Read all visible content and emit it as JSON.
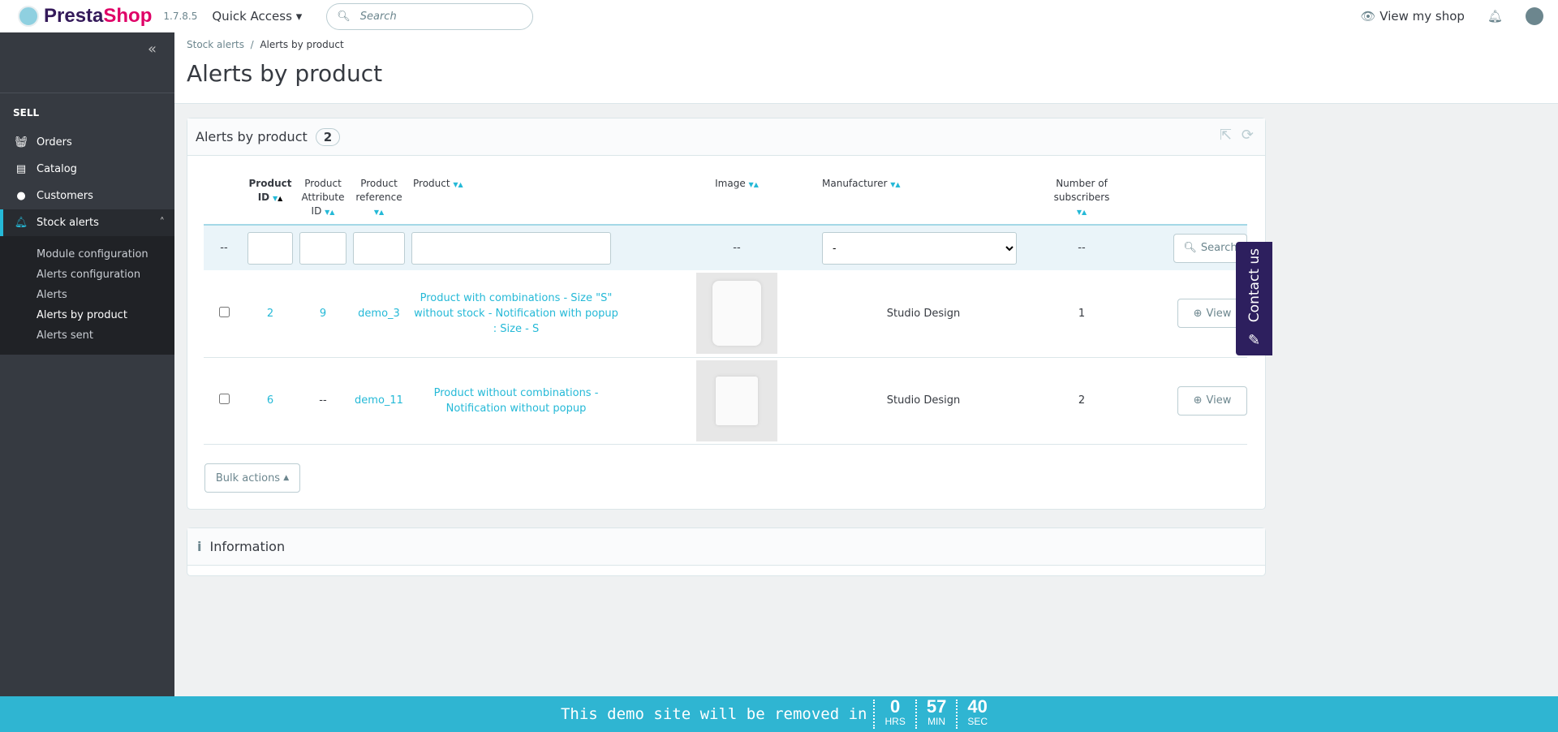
{
  "header": {
    "brand_1": "Presta",
    "brand_2": "Shop",
    "version": "1.7.8.5",
    "quick_access": "Quick Access",
    "search_placeholder": "Search",
    "view_shop": "View my shop"
  },
  "sidebar": {
    "section": "SELL",
    "items": [
      {
        "label": "Orders"
      },
      {
        "label": "Catalog"
      },
      {
        "label": "Customers"
      },
      {
        "label": "Stock alerts"
      }
    ],
    "subitems": [
      "Module configuration",
      "Alerts configuration",
      "Alerts",
      "Alerts by product",
      "Alerts sent"
    ]
  },
  "breadcrumb": {
    "parent": "Stock alerts",
    "sep": "/",
    "current": "Alerts by product"
  },
  "page_title": "Alerts by product",
  "panel": {
    "title": "Alerts by product",
    "count": "2",
    "columns": [
      "Product",
      "ID",
      "Product",
      "Attribute",
      "ID",
      "Product",
      "reference",
      "Product",
      "Image",
      "Manufacturer",
      "Number of",
      "subscribers"
    ],
    "filter": {
      "empty": "--",
      "manufacturer_selected": "-",
      "search": "Search"
    },
    "rows": [
      {
        "id": "2",
        "attr": "9",
        "ref": "demo_3",
        "product": "Product with combinations - Size \"S\" without stock - Notification with popup : Size - S",
        "manufacturer": "Studio Design",
        "subscribers": "1",
        "view": "View"
      },
      {
        "id": "6",
        "attr": "--",
        "ref": "demo_11",
        "product": "Product without combinations - Notification without popup",
        "manufacturer": "Studio Design",
        "subscribers": "2",
        "view": "View"
      }
    ],
    "bulk": "Bulk actions"
  },
  "info": {
    "title": "Information"
  },
  "contact": "Contact us",
  "demo": {
    "message": "This demo site will be removed in",
    "hrs": "0",
    "hrs_label": "HRS",
    "min": "57",
    "min_label": "MIN",
    "sec": "40",
    "sec_label": "SEC"
  }
}
